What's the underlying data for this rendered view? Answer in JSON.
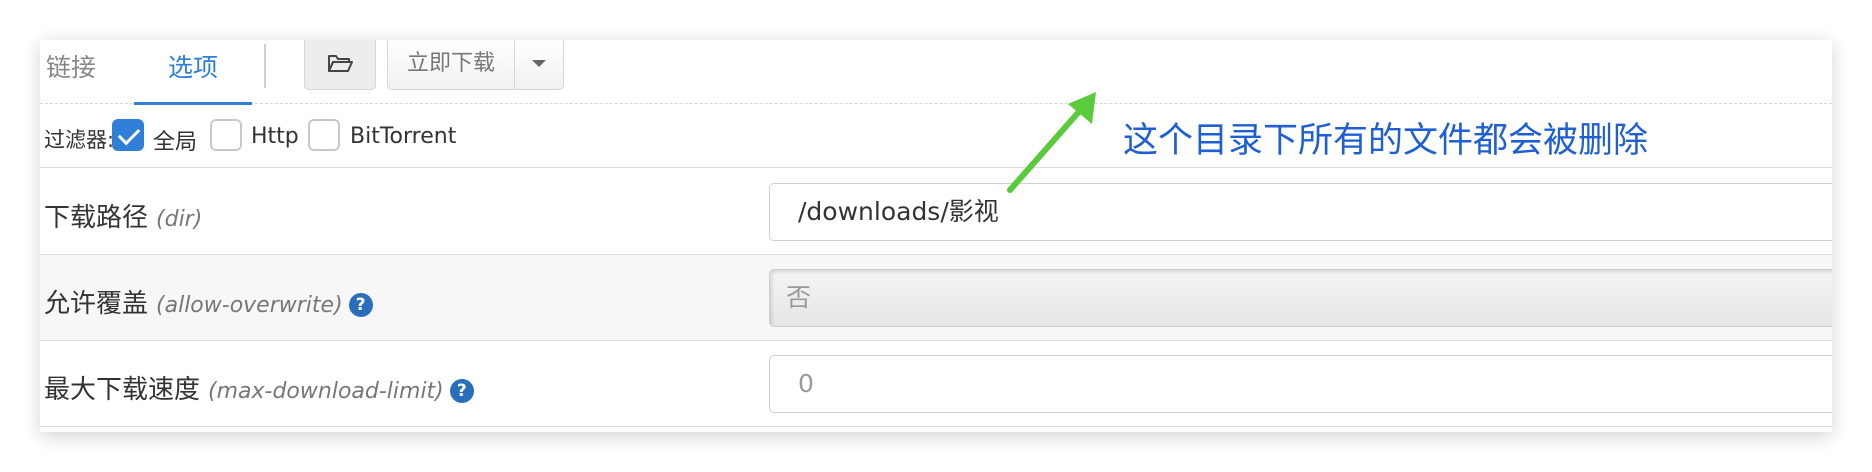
{
  "tabs": {
    "link": "链接",
    "options": "选项"
  },
  "toolbar": {
    "download_now": "立即下载",
    "folder_icon": "📂"
  },
  "filters": {
    "label": "过滤器:",
    "all": {
      "label": "全局",
      "checked": true
    },
    "http": {
      "label": "Http",
      "checked": false
    },
    "bittorrent": {
      "label": "BitTorrent",
      "checked": false
    }
  },
  "annotation": "这个目录下所有的文件都会被删除",
  "options": [
    {
      "title": "下载路径",
      "key": "(dir)",
      "value": "/downloads/影视",
      "help": false
    },
    {
      "title": "允许覆盖",
      "key": "(allow-overwrite)",
      "value": "否",
      "help": true
    },
    {
      "title": "最大下载速度",
      "key": "(max-download-limit)",
      "value": "0",
      "help": true
    }
  ],
  "help_glyph": "?",
  "colors": {
    "accent": "#2f7fd8",
    "annotation": "#1f5fd6",
    "arrow": "#5acb3a"
  }
}
